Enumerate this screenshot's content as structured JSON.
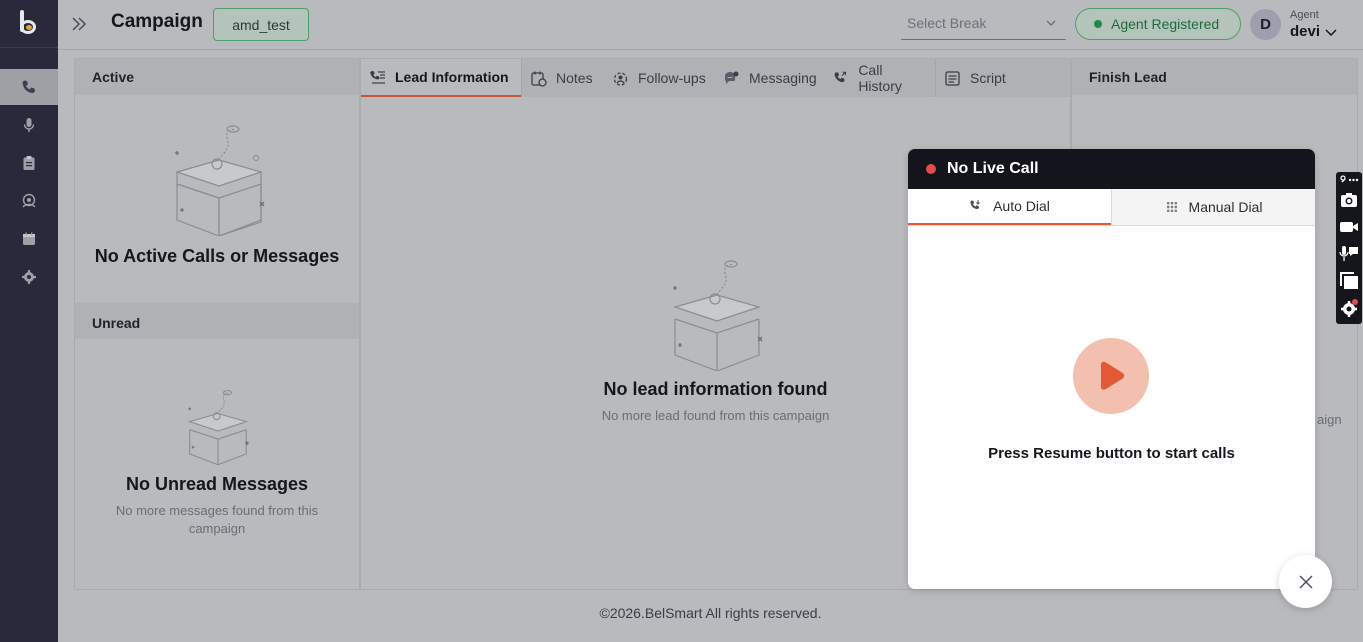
{
  "header": {
    "campaign_title": "Campaign",
    "campaign_name": "amd_test",
    "select_break_placeholder": "Select Break",
    "agent_status": "Agent Registered",
    "avatar_initial": "D",
    "agent_label": "Agent",
    "agent_name": "devi"
  },
  "sidebar": {
    "items": [
      {
        "name": "calls",
        "icon": "phone-icon",
        "active": true
      },
      {
        "name": "voice",
        "icon": "microphone-icon",
        "active": false
      },
      {
        "name": "tasks",
        "icon": "clipboard-icon",
        "active": false
      },
      {
        "name": "follow-ups",
        "icon": "support-agent-icon",
        "active": false
      },
      {
        "name": "calendar",
        "icon": "calendar-icon",
        "active": false
      },
      {
        "name": "settings",
        "icon": "gear-icon",
        "active": false
      }
    ]
  },
  "left_panel": {
    "active_title": "Active",
    "active_empty_title": "No Active Calls or Messages",
    "unread_title": "Unread",
    "unread_empty_title": "No Unread Messages",
    "unread_empty_sub": "No more messages found from this campaign"
  },
  "center_panel": {
    "tabs": [
      {
        "label": "Lead Information",
        "icon": "lead-list-icon",
        "active": true
      },
      {
        "label": "Notes",
        "icon": "notes-icon",
        "active": false
      },
      {
        "label": "Follow-ups",
        "icon": "follow-up-icon",
        "active": false
      },
      {
        "label": "Messaging",
        "icon": "chat-icon",
        "active": false
      },
      {
        "label": "Call History",
        "icon": "phone-history-icon",
        "active": false
      },
      {
        "label": "Script",
        "icon": "script-icon",
        "active": false
      }
    ],
    "empty_title": "No lead information found",
    "empty_sub": "No more lead found from this campaign"
  },
  "right_panel": {
    "title": "Finish Lead",
    "partial_text": "aign"
  },
  "dialer": {
    "status": "No Live Call",
    "tabs": [
      "Auto Dial",
      "Manual Dial"
    ],
    "prompt": "Press Resume button to start calls"
  },
  "footer": {
    "copyright": "©2026.BelSmart All rights reserved."
  },
  "colors": {
    "sidebar": "#282a3c",
    "accent": "#e25a33",
    "status_green": "#1d8a4a",
    "live_red": "#e64b4b"
  }
}
